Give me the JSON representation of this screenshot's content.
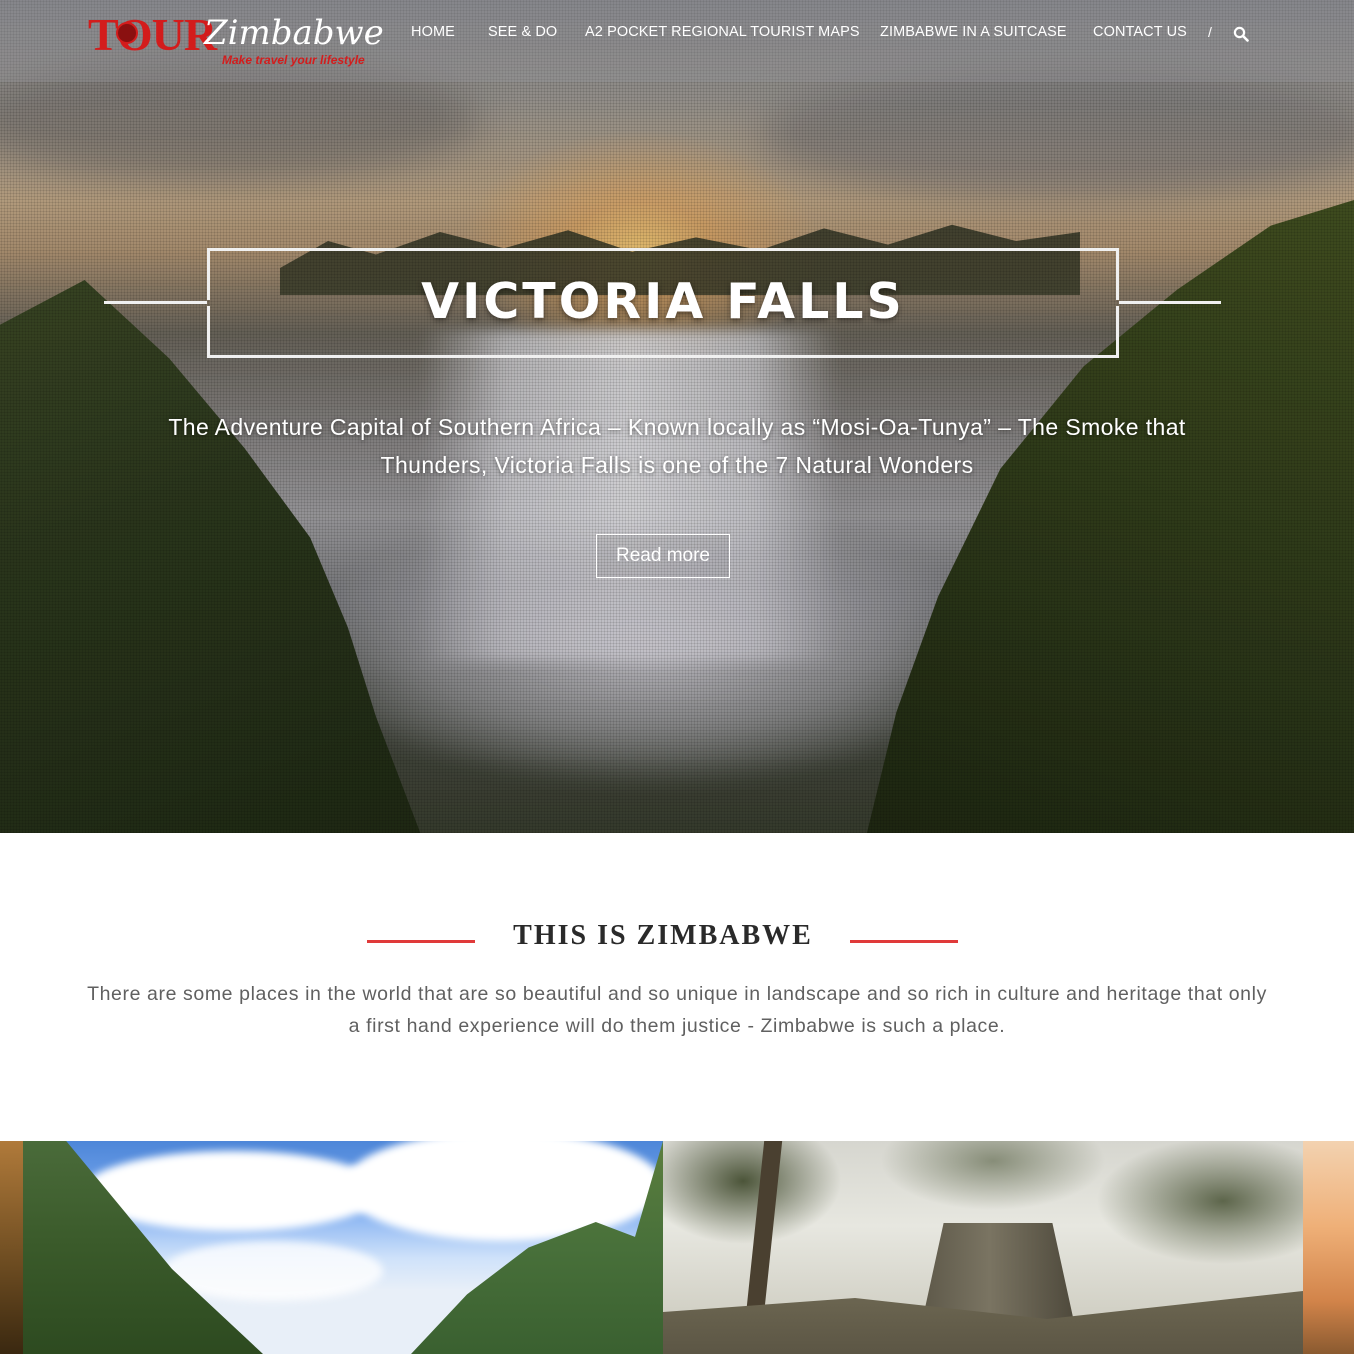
{
  "brand": {
    "logo_main": "TOUR",
    "logo_script": "Zimbabwe",
    "tagline": "Make travel your lifestyle",
    "brand_red": "#d31c1c"
  },
  "nav": {
    "items": [
      {
        "label": "HOME"
      },
      {
        "label": "SEE & DO"
      },
      {
        "label": "A2 POCKET REGIONAL TOURIST MAPS"
      },
      {
        "label": "ZIMBABWE IN A SUITCASE"
      },
      {
        "label": "CONTACT US"
      }
    ],
    "separator": "/",
    "search_icon": "search-icon"
  },
  "hero": {
    "title": "VICTORIA FALLS",
    "subtitle": "The Adventure Capital of Southern Africa – Known locally as “Mosi-Oa-Tunya” – The Smoke that Thunders, Victoria Falls is one of the 7 Natural Wonders",
    "cta_label": "Read more"
  },
  "intro": {
    "heading": "THIS IS ZIMBABWE",
    "body": "There are some places in the world that are so beautiful and so unique in landscape and so rich in culture and heritage that only a first hand experience will do them justice - Zimbabwe is such a place.",
    "accent_color": "#e03a3a"
  }
}
